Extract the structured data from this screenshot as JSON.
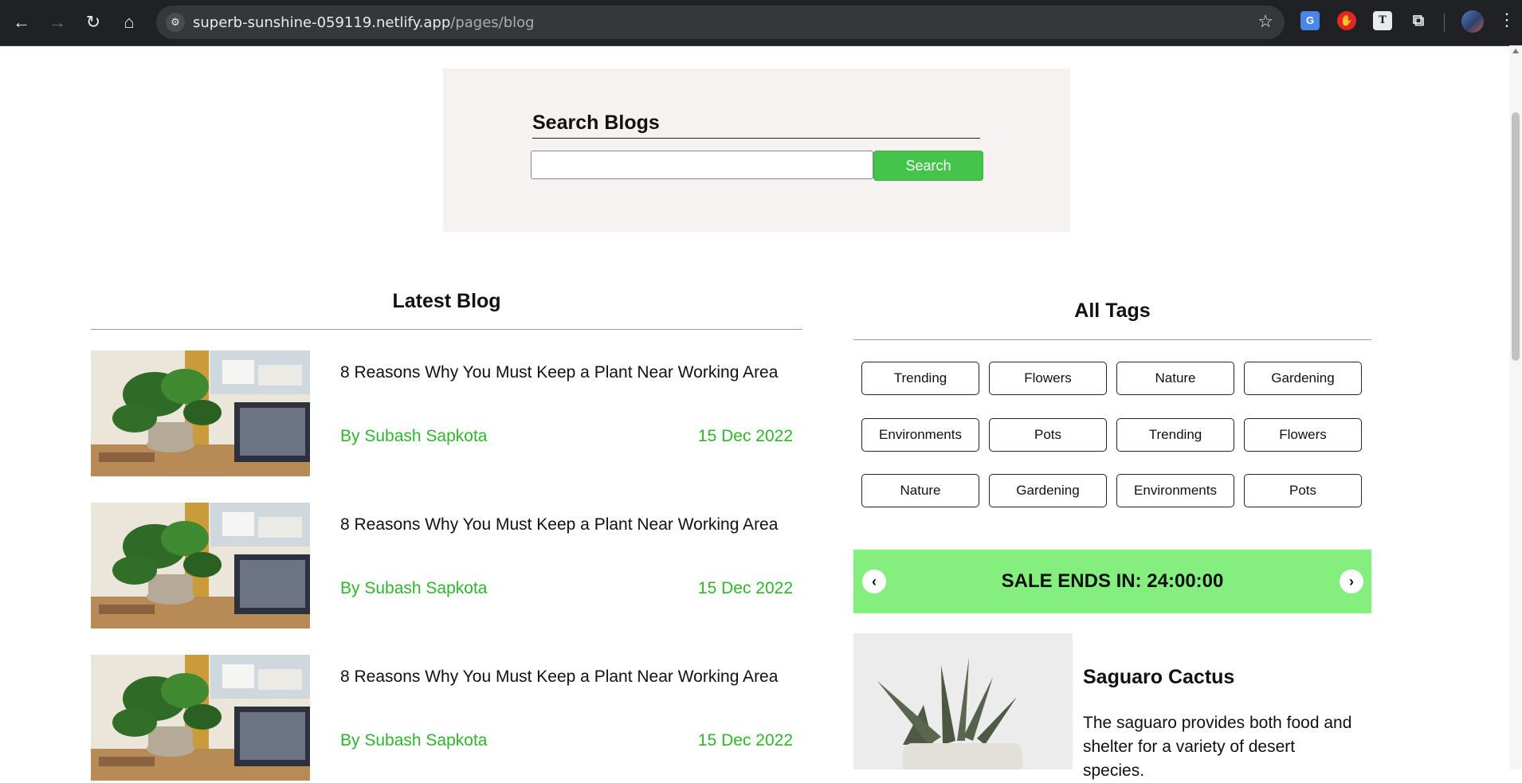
{
  "browser": {
    "url_host": "superb-sunshine-059119.netlify.app",
    "url_path": "/pages/blog"
  },
  "search": {
    "title": "Search Blogs",
    "input_value": "",
    "button_label": "Search"
  },
  "latest": {
    "title": "Latest Blog",
    "posts": [
      {
        "title": "8 Reasons Why You Must Keep a Plant Near Working Area",
        "author": "By Subash Sapkota",
        "date": "15 Dec 2022"
      },
      {
        "title": "8 Reasons Why You Must Keep a Plant Near Working Area",
        "author": "By Subash Sapkota",
        "date": "15 Dec 2022"
      },
      {
        "title": "8 Reasons Why You Must Keep a Plant Near Working Area",
        "author": "By Subash Sapkota",
        "date": "15 Dec 2022"
      }
    ]
  },
  "tags": {
    "title": "All Tags",
    "items": [
      "Trending",
      "Flowers",
      "Nature",
      "Gardening",
      "Environments",
      "Pots",
      "Trending",
      "Flowers",
      "Nature",
      "Gardening",
      "Environments",
      "Pots"
    ]
  },
  "sale": {
    "text": "SALE ENDS IN: 24:00:00"
  },
  "product": {
    "name": "Saguaro Cactus",
    "description": "The saguaro provides both food and shelter for a variety of desert species."
  },
  "colors": {
    "accent_green": "#44c44a",
    "author_green": "#2fb52c",
    "sale_green": "#84ef7f"
  }
}
